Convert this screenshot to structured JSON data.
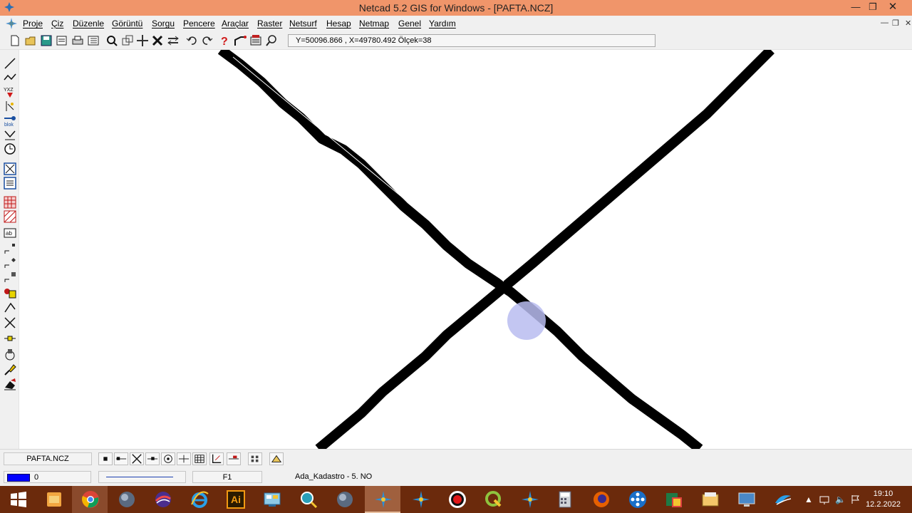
{
  "window": {
    "title": "Netcad 5.2 GIS for Windows - [PAFTA.NCZ]"
  },
  "menu": {
    "items": [
      {
        "label": "Proje"
      },
      {
        "label": "Çiz"
      },
      {
        "label": "Düzenle"
      },
      {
        "label": "Görüntü"
      },
      {
        "label": "Sorgu"
      },
      {
        "label": "Pencere"
      },
      {
        "label": "Araçlar"
      },
      {
        "label": "Raster"
      },
      {
        "label": "Netsurf"
      },
      {
        "label": "Hesap"
      },
      {
        "label": "Netmap"
      },
      {
        "label": "Genel"
      },
      {
        "label": "Yardım"
      }
    ]
  },
  "toolbar": {
    "coordinates": "Y=50096.866 , X=49780.492 Ölçek=38"
  },
  "left_toolbar": {
    "blok_label": "blok",
    "xyz_label": "YXZ",
    "text_label": "ab"
  },
  "bottom": {
    "file_tab": "PAFTA.NCZ"
  },
  "status": {
    "layer_color": "#0000ff",
    "layer_number": "0",
    "function_key": "F1",
    "info": "Ada_Kadastro -    5. NO"
  },
  "taskbar": {
    "time": "19:10",
    "date": "12.2.2022",
    "illustrator_label": "Ai"
  },
  "colors": {
    "titlebar": "#f0956a",
    "taskbar": "#6b2a0c",
    "cursor_highlight": "#b8bcf0"
  }
}
